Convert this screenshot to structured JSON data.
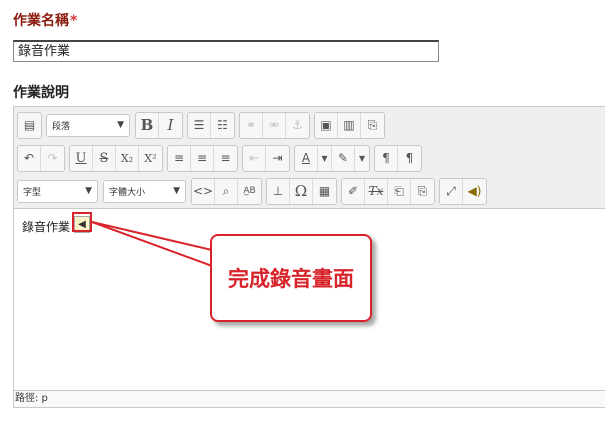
{
  "form": {
    "name_label": "作業名稱",
    "required_mark": "*",
    "name_value": "錄音作業",
    "desc_label": "作業說明"
  },
  "toolbar": {
    "row1": {
      "paragraph_select": "段落",
      "bold": "B",
      "italic": "I"
    },
    "row2": {
      "underline": "U",
      "strike": "S",
      "subscript": "X₂",
      "superscript": "X²",
      "ltr": "¶",
      "rtl": "¶"
    },
    "row3": {
      "font_select": "字型",
      "size_select": "字體大小",
      "code": "<>",
      "omega": "Ω",
      "clear_format": "Tx"
    }
  },
  "editor": {
    "content_text": "錄音作業",
    "path": "路徑: p"
  },
  "annotation": {
    "callout_text": "完成錄音畫面"
  },
  "colors": {
    "label_red": "#8b1b0f",
    "annotation_red": "#d8232a"
  }
}
